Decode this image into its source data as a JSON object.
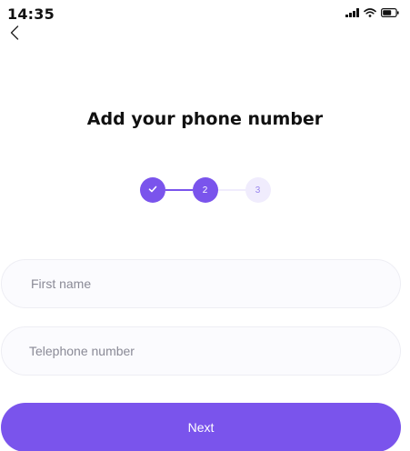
{
  "status_bar": {
    "time": "14:35",
    "icons": [
      "signal-icon",
      "wifi-icon",
      "battery-icon"
    ]
  },
  "header": {
    "back_icon": "chevron-left-icon",
    "title": "Add your phone number"
  },
  "stepper": {
    "steps": [
      {
        "label": "",
        "state": "completed",
        "icon": "check-icon"
      },
      {
        "label": "2",
        "state": "active"
      },
      {
        "label": "3",
        "state": "upcoming"
      }
    ]
  },
  "form": {
    "first_name": {
      "value": "",
      "placeholder": "First name"
    },
    "telephone": {
      "value": "",
      "placeholder": "Telephone number"
    }
  },
  "actions": {
    "next_label": "Next"
  },
  "colors": {
    "accent": "#7a54ec",
    "accent_light": "#f0ecfd",
    "field_bg": "#fbfbfe",
    "field_border": "#eeeef4"
  }
}
